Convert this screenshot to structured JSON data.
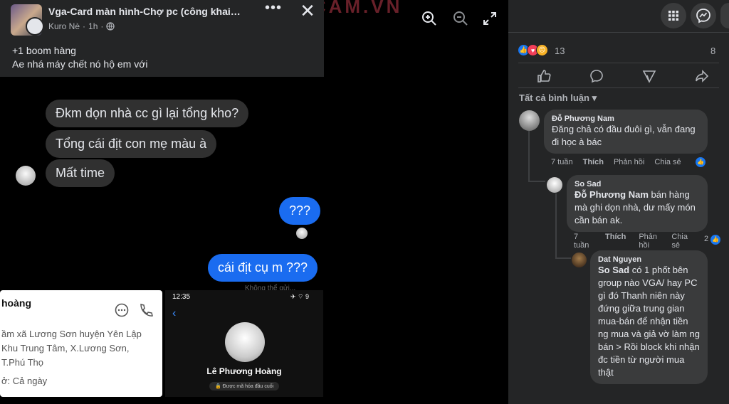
{
  "watermark": "CHECKSCAM.VN",
  "post": {
    "group_name": "Vga-Card màn hình-Chợ pc (công khai gi...",
    "author": "Kuro Nè",
    "time": "1h",
    "line1": "+1 boom hàng",
    "line2": "Ae nhá máy chết nó hộ em với",
    "more": "•••",
    "close": "✕"
  },
  "chat": {
    "msg1": "Đkm dọn nhà cc gì lại tổng kho?",
    "msg2": "Tổng cái địt con mẹ màu à",
    "msg3": "Mất time",
    "msg4": "???",
    "msg5": "cái địt cụ m ???",
    "footer": "Không thể gửi..."
  },
  "contact": {
    "name": "hoàng",
    "address": "ầm xã Lương Sơn huyện Yên Lập Khu Trung Tâm, X.Lương Sơn, T.Phú Thọ",
    "hours": "ở: Cả ngày"
  },
  "phone": {
    "time": "12:35",
    "status": "✈ ⌔ 9",
    "back": "‹",
    "name": "Lê Phương Hoàng",
    "encrypted": "🔒 Được mã hóa đầu cuối"
  },
  "panel": {
    "reaction_count": "13",
    "comment_count": "8",
    "sort_label": "Tất cả bình luận ▾",
    "comments": [
      {
        "name": "Đỗ Phương Nam",
        "text": "Đăng chả có đầu đuôi gì, vẫn đang đi học à bác",
        "time": "7 tuần",
        "like": "Thích",
        "reply": "Phản hồi",
        "share": "Chia sẻ"
      },
      {
        "name": "So Sad",
        "mention": "Đỗ Phương Nam",
        "text": " bán hàng mà ghi dọn nhà, dư mấy món cần bán ak.",
        "time": "7 tuần",
        "like": "Thích",
        "reply": "Phản hồi",
        "share": "Chia sẻ",
        "likes": "2"
      },
      {
        "name": "Dat Nguyen",
        "mention": "So Sad",
        "text": " có 1 phốt bên group nào VGA/ hay PC gì đó Thanh niên này đứng giữa trung gian mua-bán để nhận tiền ng mua và giả vờ làm ng bán > Rồi block khi nhận đc tiền từ người mua thật"
      }
    ]
  },
  "colors": {
    "accent": "#1877f2",
    "panel_bg": "#242526",
    "bubble_me": "#1a6cf0"
  }
}
